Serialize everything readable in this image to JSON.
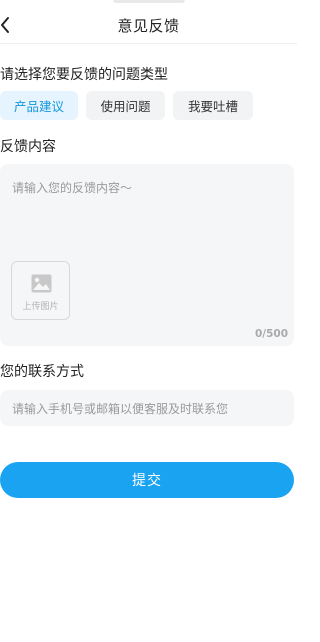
{
  "header": {
    "title": "意见反馈",
    "back_icon": "chevron-left-icon"
  },
  "feedback_type": {
    "label": "请选择您要反馈的问题类型",
    "options": [
      {
        "label": "产品建议",
        "selected": true
      },
      {
        "label": "使用问题",
        "selected": false
      },
      {
        "label": "我要吐槽",
        "selected": false
      }
    ]
  },
  "content": {
    "label": "反馈内容",
    "placeholder": "请输入您的反馈内容～",
    "upload": {
      "icon": "image-icon",
      "label": "上传图片"
    },
    "char_count": "0/500"
  },
  "contact": {
    "label": "您的联系方式",
    "placeholder": "请输入手机号或邮箱以便客服及时联系您"
  },
  "submit": {
    "label": "提交"
  },
  "colors": {
    "accent": "#1aa3f0",
    "chip_active_bg": "#e6f4ff",
    "chip_active_text": "#1296db",
    "field_bg": "#f5f6f8"
  }
}
